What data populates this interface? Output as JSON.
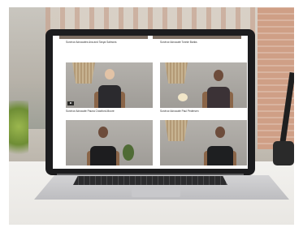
{
  "scene": {
    "description_tag": "photo",
    "colors": {
      "laptop_bezel": "#1c1c1e",
      "screen_background": "#ffffff",
      "desk": "#f2f1ee"
    }
  },
  "screen": {
    "videos": [
      {
        "caption": "Survivor Advocates Ana and Tanya Salmons"
      },
      {
        "caption": "Survivor Advocate Tonnie Banks"
      },
      {
        "caption": "Survivor Advocate Pauna Crawford-Moore"
      },
      {
        "caption": "Survivor Advocate Paul Pedersen"
      },
      {
        "caption": ""
      },
      {
        "caption": ""
      }
    ]
  }
}
